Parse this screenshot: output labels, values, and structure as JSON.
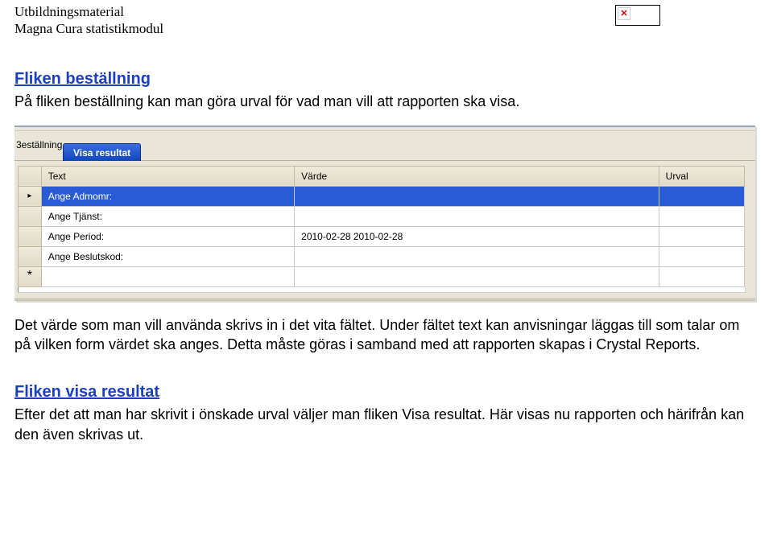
{
  "header_line1": "Utbildningsmaterial",
  "header_line2": "Magna Cura statistikmodul",
  "section1": {
    "title": "Fliken beställning",
    "para": "På fliken beställning kan man göra urval för vad man vill att rapporten ska visa."
  },
  "ui": {
    "partial_label": "3eställning",
    "tab_active": "Visa resultat",
    "columns": {
      "c1": "Text",
      "c2": "Värde",
      "c3": "Urval"
    },
    "rows": [
      {
        "text": "Ange Admomr:",
        "value": "",
        "urval": ""
      },
      {
        "text": "Ange Tjänst:",
        "value": "",
        "urval": ""
      },
      {
        "text": "Ange Period:",
        "value": "2010-02-28 2010-02-28",
        "urval": ""
      },
      {
        "text": "Ange Beslutskod:",
        "value": "",
        "urval": ""
      }
    ]
  },
  "para_after_ui": "Det värde som man vill använda skrivs in i det vita fältet. Under fältet text kan anvisningar läggas till som talar om på vilken form värdet ska anges. Detta måste göras i samband med att rapporten skapas i Crystal Reports.",
  "section2": {
    "title": "Fliken visa resultat",
    "para": "Efter det att man har skrivit i önskade urval väljer man fliken Visa resultat. Här visas nu rapporten och härifrån kan den även skrivas ut."
  }
}
